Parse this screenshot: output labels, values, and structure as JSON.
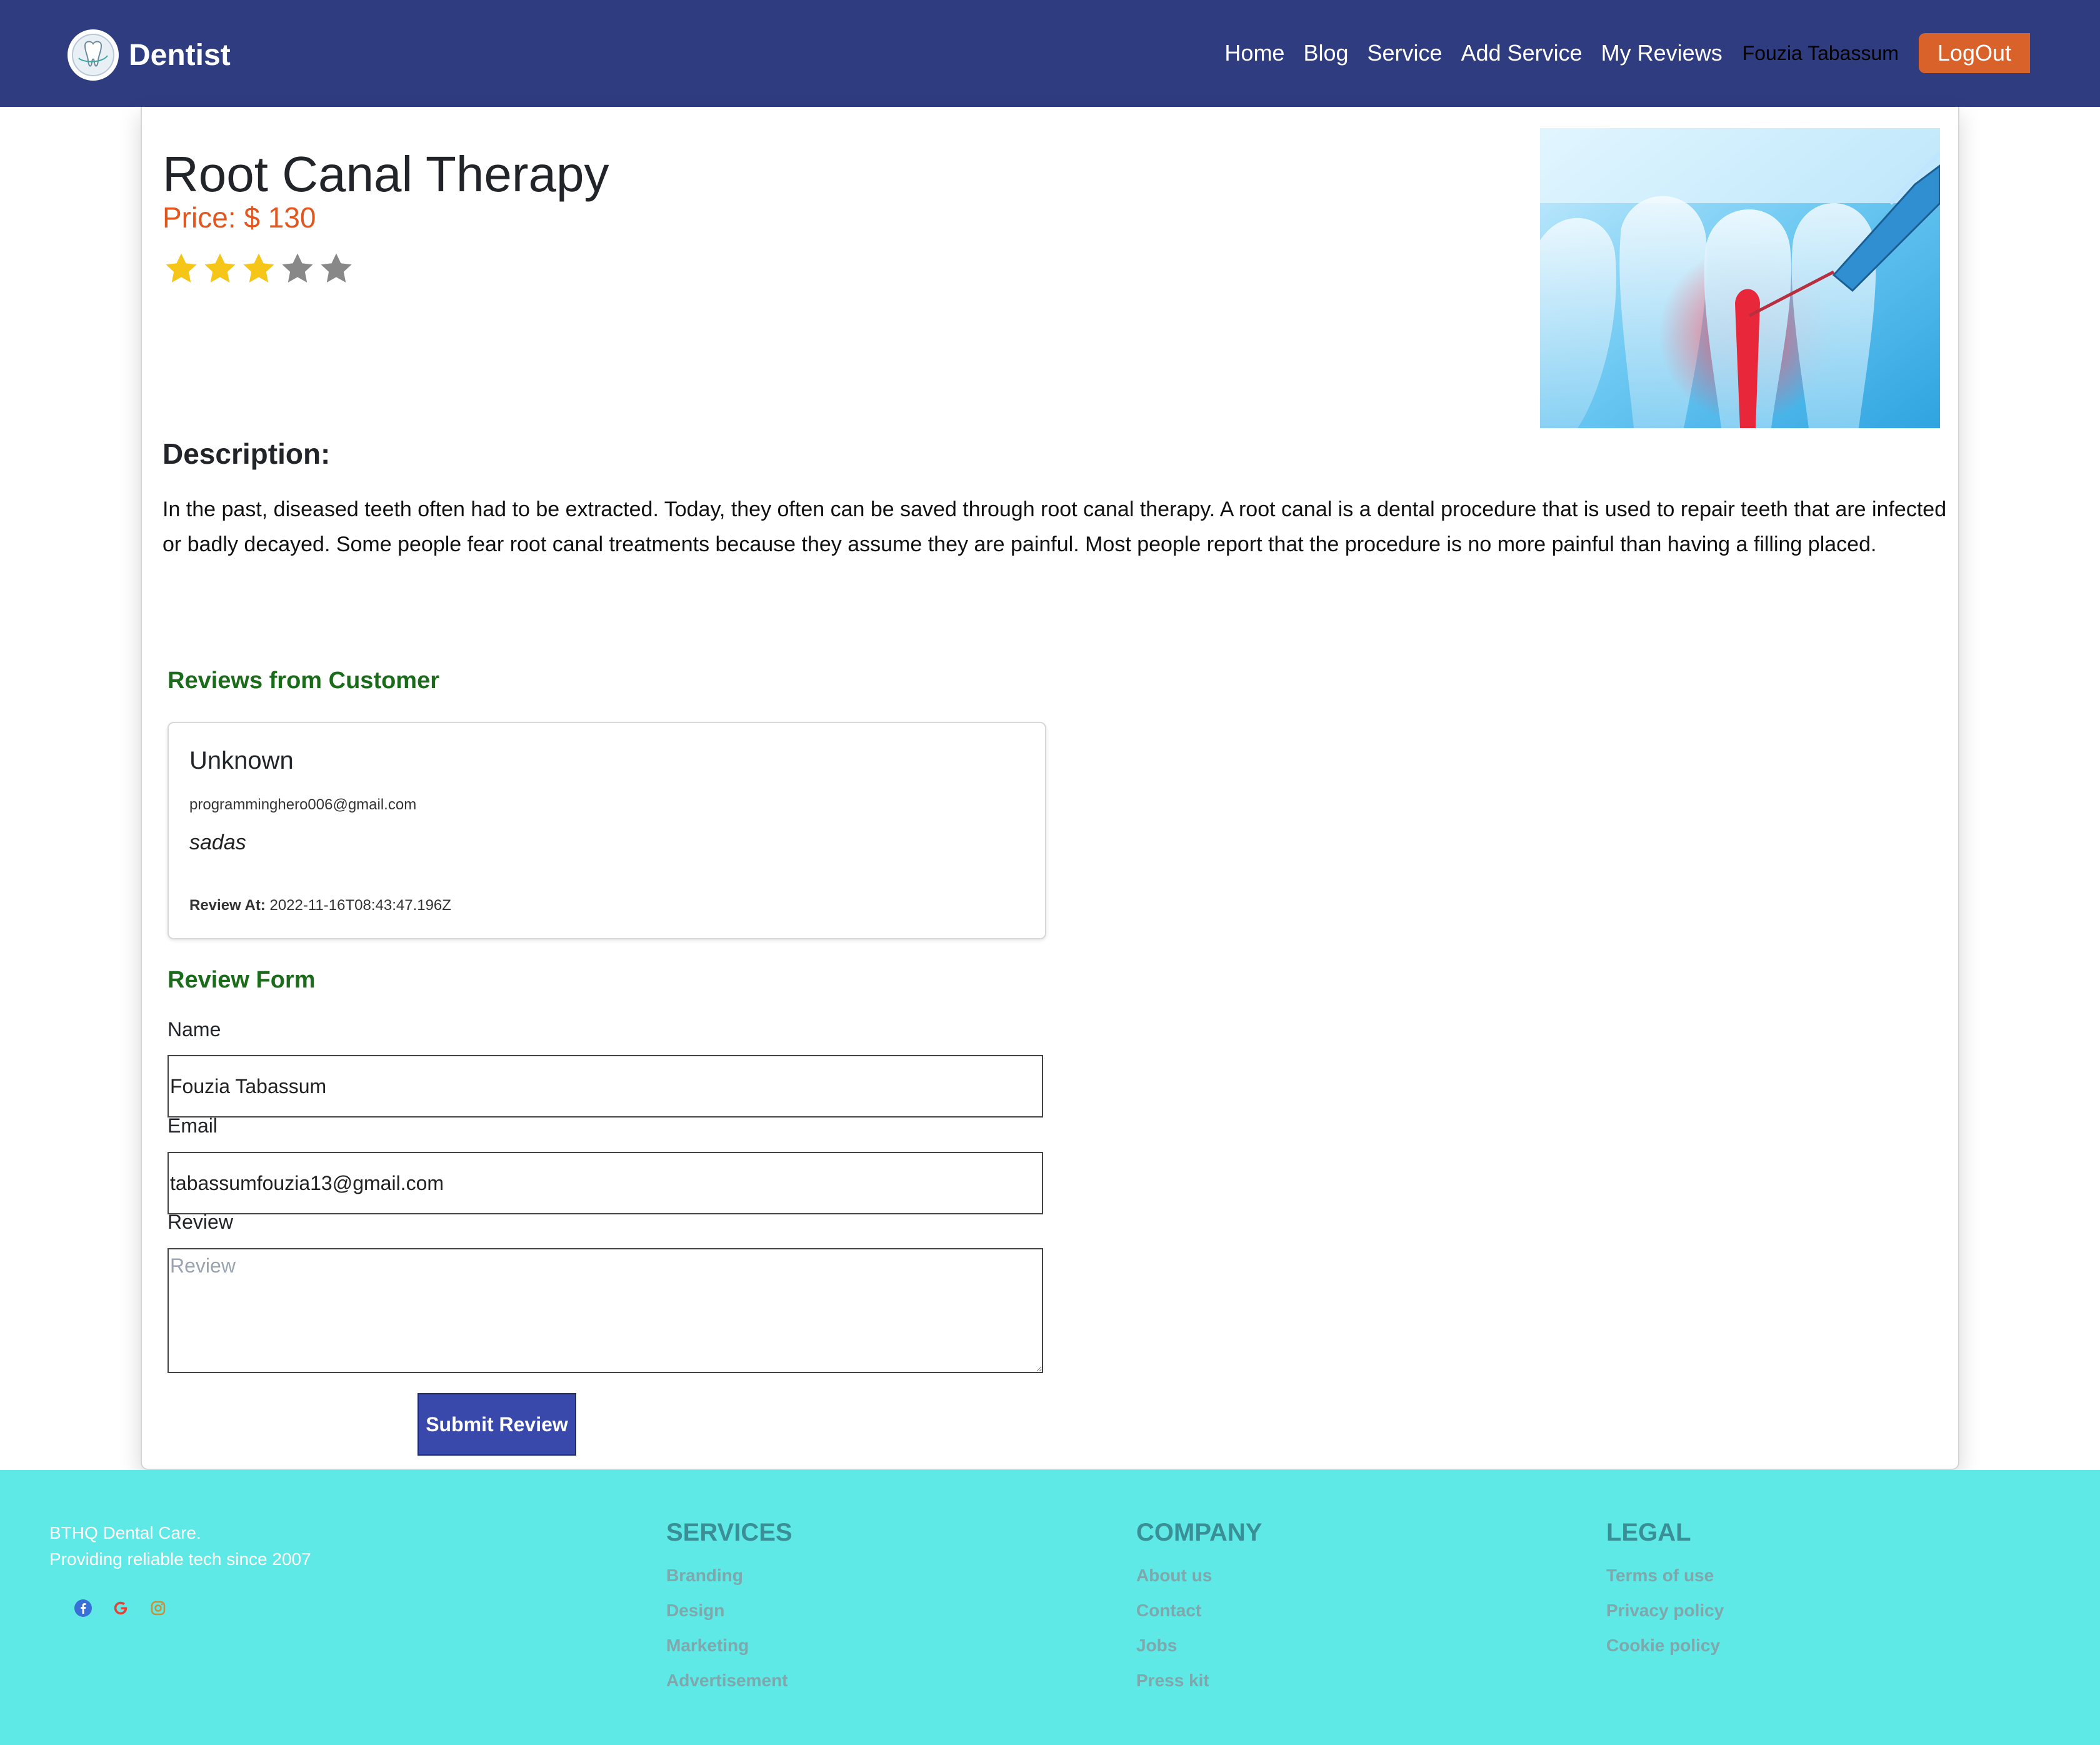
{
  "navbar": {
    "brand": "Dentist",
    "links": [
      "Home",
      "Blog",
      "Service",
      "Add Service",
      "My Reviews"
    ],
    "user": "Fouzia Tabassum",
    "logout": "LogOut"
  },
  "service": {
    "title": "Root Canal Therapy",
    "price": "Price: $ 130",
    "rating": 3,
    "rating_max": 5,
    "description_heading": "Description:",
    "description": "In the past, diseased teeth often had to be extracted. Today, they often can be saved through root canal therapy. A root canal is a dental procedure that is used to repair teeth that are infected or badly decayed. Some people fear root canal treatments because they assume they are painful. Most people report that the procedure is no more painful than having a filling placed."
  },
  "reviews": {
    "heading": "Reviews from Customer",
    "items": [
      {
        "name": "Unknown",
        "email": "programminghero006@gmail.com",
        "text": "sadas",
        "date_label": "Review At:",
        "date": "2022-11-16T08:43:47.196Z"
      }
    ]
  },
  "form": {
    "heading": "Review Form",
    "name_label": "Name",
    "name_value": "Fouzia Tabassum",
    "email_label": "Email",
    "email_value": "tabassumfouzia13@gmail.com",
    "review_label": "Review",
    "review_placeholder": "Review",
    "submit": "Submit Review"
  },
  "footer": {
    "about_line1": "BTHQ Dental Care.",
    "about_line2": "Providing reliable tech since 2007",
    "social_icons": [
      "facebook-icon",
      "google-icon",
      "instagram-icon"
    ],
    "services": {
      "heading": "SERVICES",
      "links": [
        "Branding",
        "Design",
        "Marketing",
        "Advertisement"
      ]
    },
    "company": {
      "heading": "COMPANY",
      "links": [
        "About us",
        "Contact",
        "Jobs",
        "Press kit"
      ]
    },
    "legal": {
      "heading": "LEGAL",
      "links": [
        "Terms of use",
        "Privacy policy",
        "Cookie policy"
      ]
    }
  },
  "colors": {
    "navbar": "#2f3d80",
    "logout": "#d9622b",
    "price": "#e0561e",
    "star_filled": "#f5c518",
    "star_empty": "#888888",
    "section_heading": "#1a6b1a",
    "submit": "#3949ab",
    "footer": "#5ee8e6"
  }
}
